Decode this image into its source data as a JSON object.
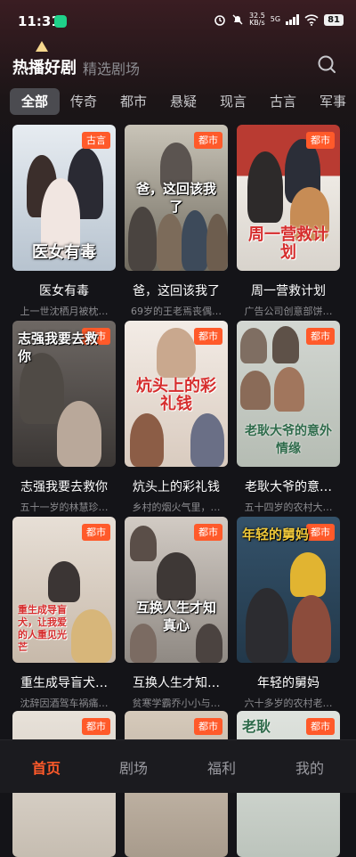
{
  "status_bar": {
    "time": "11:31",
    "speed_value": "32.5",
    "speed_unit": "KB/s",
    "network": "5G",
    "battery": "81"
  },
  "header": {
    "title": "热播好剧",
    "subtitle": "精选剧场"
  },
  "tabs": [
    "全部",
    "传奇",
    "都市",
    "悬疑",
    "现言",
    "古言",
    "军事"
  ],
  "cards": [
    {
      "name": "医女有毒",
      "desc": "上一世沈栖月被枕…",
      "badge": "古言",
      "poster_text": "医女有毒",
      "bg": "#cfd7e0"
    },
    {
      "name": "爸，这回该我了",
      "desc": "69岁的王老焉丧偶…",
      "badge": "都市",
      "poster_text": "爸，这回该我了",
      "bg": "#8d8a7e"
    },
    {
      "name": "周一营救计划",
      "desc": "广告公司创意部饼…",
      "badge": "都市",
      "poster_text": "周一营救计划",
      "bg": "#e3e0da"
    },
    {
      "name": "志强我要去救你",
      "desc": "五十一岁的林慧珍…",
      "badge": "都市",
      "poster_text": "志强我要去救你",
      "bg": "#5a5552"
    },
    {
      "name": "炕头上的彩礼钱",
      "desc": "乡村的烟火气里，…",
      "badge": "都市",
      "poster_text": "炕头上的彩礼钱",
      "bg": "#efe6df"
    },
    {
      "name": "老耿大爷的意…",
      "desc": "五十四岁的农村大…",
      "badge": "都市",
      "poster_text": "老耿大爷的意外情缘",
      "bg": "#c7cfc9"
    },
    {
      "name": "重生成导盲犬…",
      "desc": "沈辞因酒驾车祸痛…",
      "badge": "都市",
      "poster_text": "重生成导盲犬，让我爱的人重见光芒",
      "bg": "#d8cfc4"
    },
    {
      "name": "互换人生才知…",
      "desc": "贫寒学霸乔小小与…",
      "badge": "都市",
      "poster_text": "互换人生才知真心",
      "bg": "#b8b3ae"
    },
    {
      "name": "年轻的舅妈",
      "desc": "六十多岁的农村老…",
      "badge": "都市",
      "poster_text": "年轻的舅妈",
      "bg": "#2f4a5e"
    },
    {
      "name": "",
      "desc": "",
      "badge": "都市",
      "poster_text": "",
      "bg": "#d9d4cc"
    },
    {
      "name": "",
      "desc": "",
      "badge": "都市",
      "poster_text": "",
      "bg": "#c9bfb2"
    },
    {
      "name": "",
      "desc": "",
      "badge": "都市",
      "poster_text": "老耿",
      "bg": "#ccd2cc"
    }
  ],
  "bottom_nav": [
    "首页",
    "剧场",
    "福利",
    "我的"
  ],
  "colors": {
    "accent": "#ff5a2a",
    "background": "#141418"
  }
}
